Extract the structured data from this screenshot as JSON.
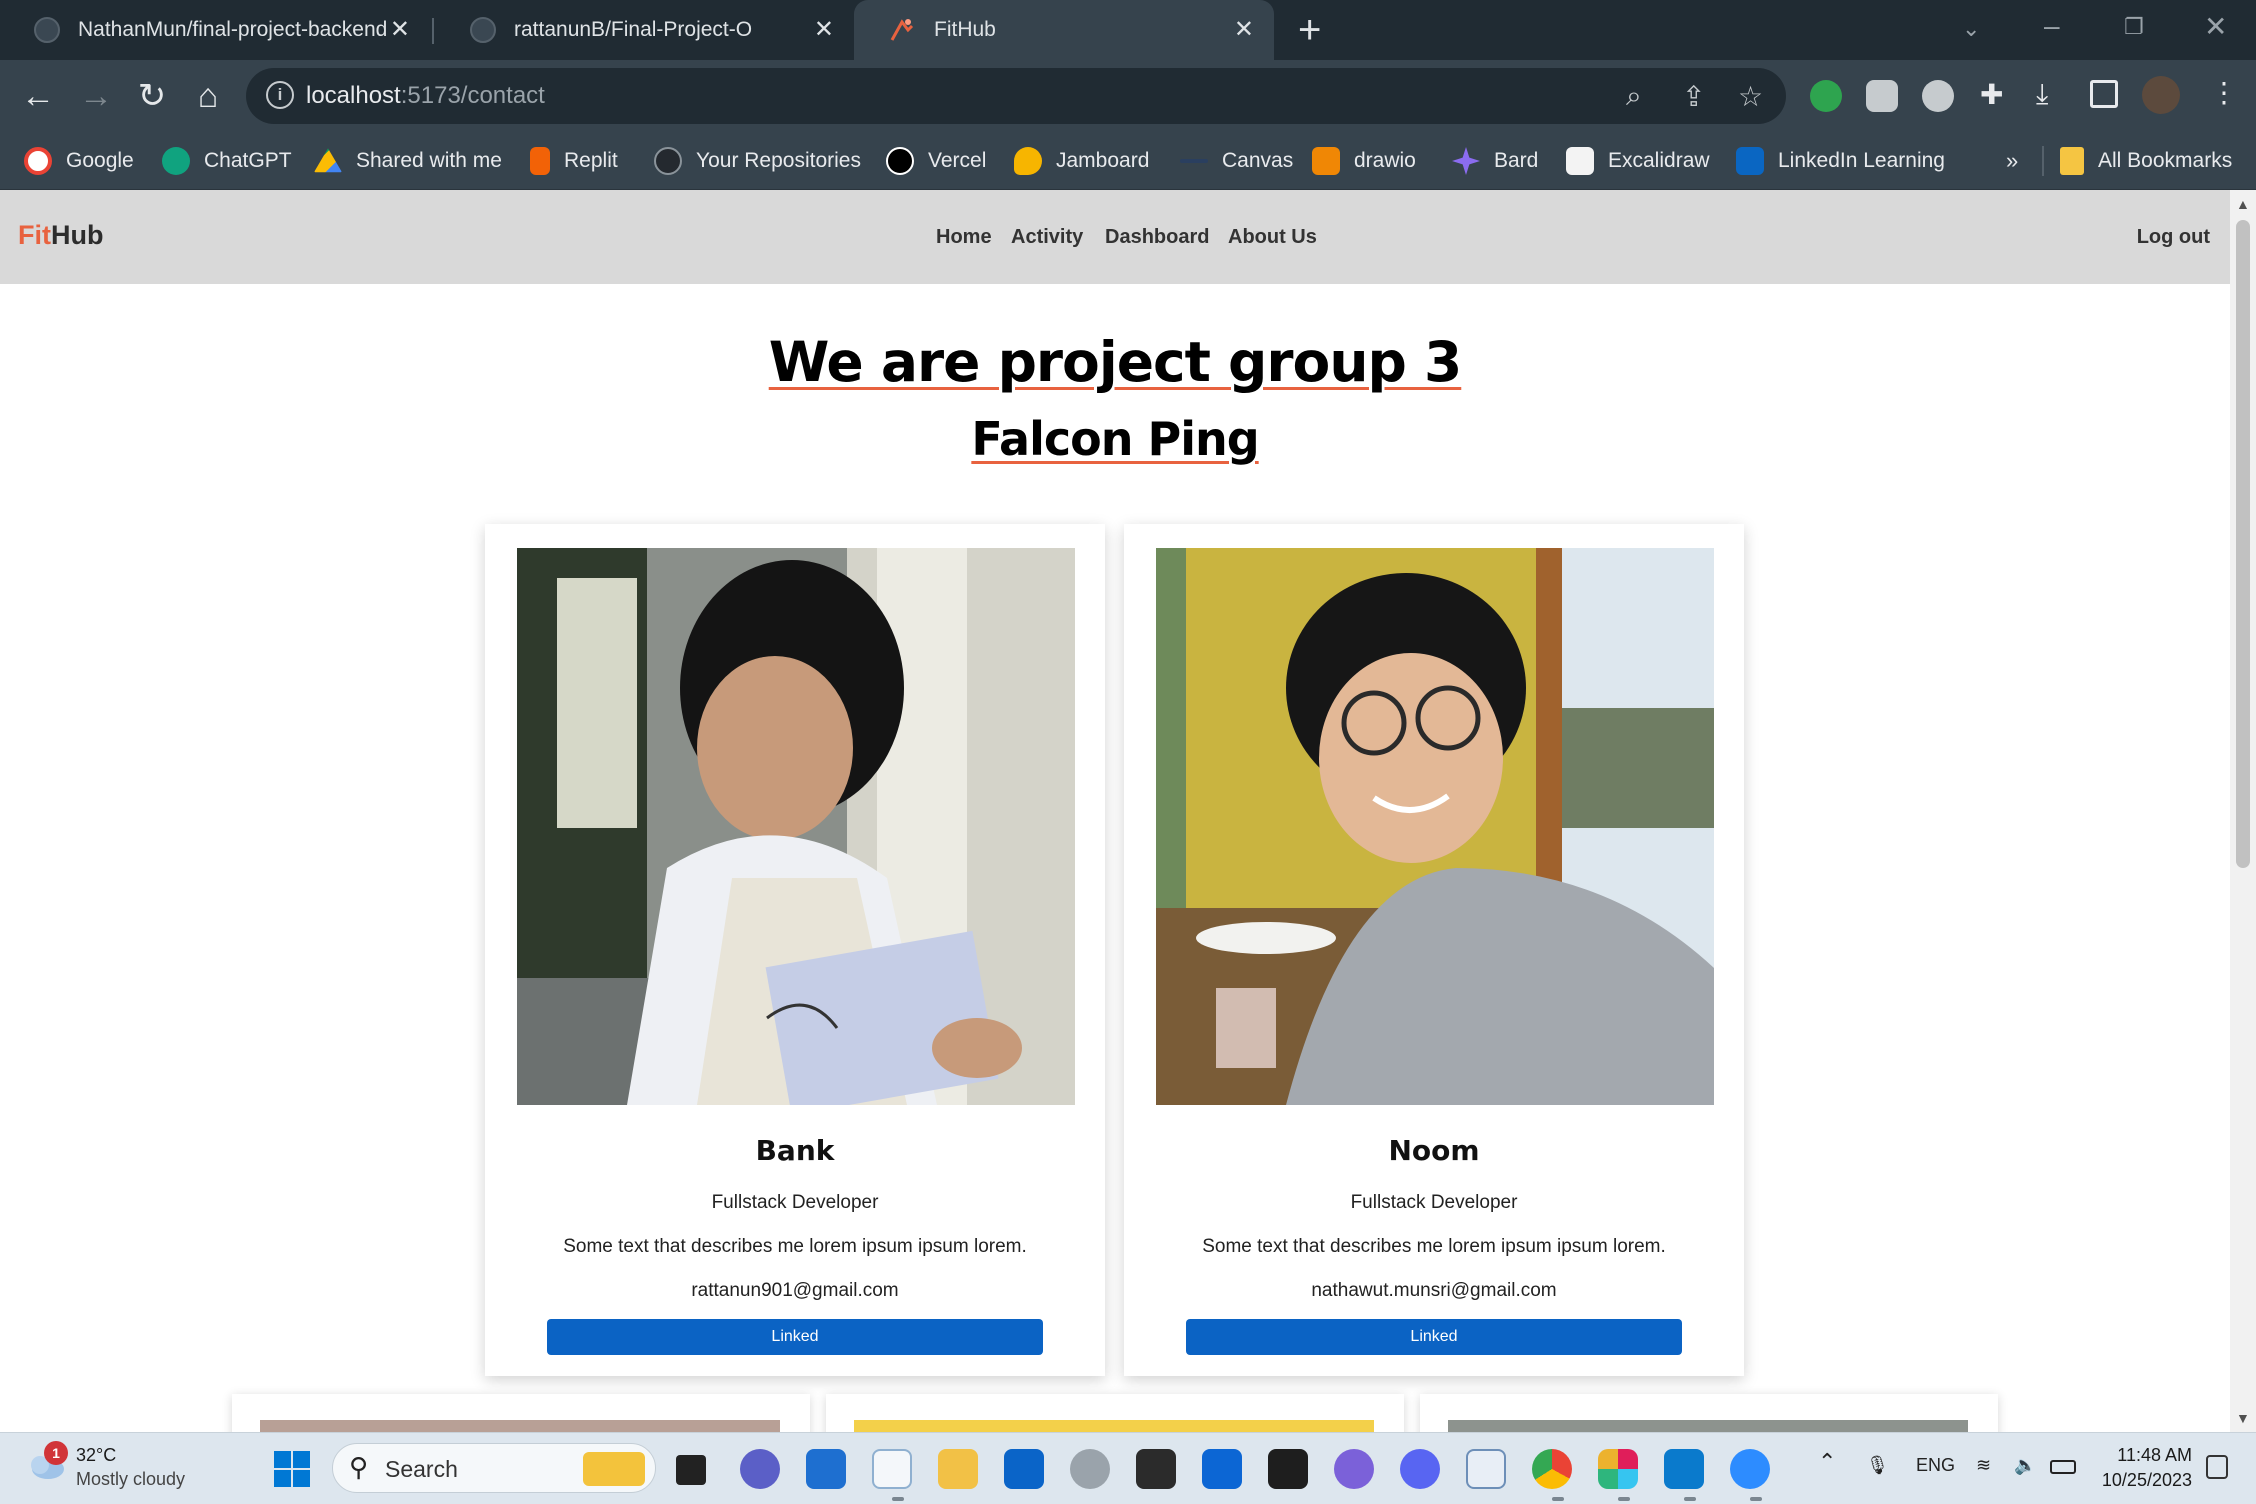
{
  "browser": {
    "tabs": [
      {
        "title": "NathanMun/final-project-backend",
        "active": false
      },
      {
        "title": "rattanunB/Final-Project-O",
        "active": false
      },
      {
        "title": "FitHub",
        "active": true
      }
    ],
    "url_host": "localhost",
    "url_rest": ":5173/contact",
    "bookmarks": [
      {
        "label": "Google",
        "color": "#ea4335"
      },
      {
        "label": "ChatGPT",
        "color": "#10a37f"
      },
      {
        "label": "Shared with me",
        "color": "#fbbc04"
      },
      {
        "label": "Replit",
        "color": "#f26207"
      },
      {
        "label": "Your Repositories",
        "color": "#24292f"
      },
      {
        "label": "Vercel",
        "color": "#000000"
      },
      {
        "label": "Jamboard",
        "color": "#f7b500"
      },
      {
        "label": "Canvas",
        "color": "#2a3f5f"
      },
      {
        "label": "drawio",
        "color": "#f08705"
      },
      {
        "label": "Bard",
        "color": "#8b6cf0"
      },
      {
        "label": "Excalidraw",
        "color": "#f3f3f3"
      },
      {
        "label": "LinkedIn Learning",
        "color": "#0a66c2"
      }
    ],
    "bookmarks_overflow": "»",
    "all_bookmarks": "All Bookmarks"
  },
  "site": {
    "brand_fit": "Fit",
    "brand_hub": "Hub",
    "nav": [
      "Home",
      "Activity",
      "Dashboard",
      "About Us"
    ],
    "logout": "Log out",
    "headline": "We are project group 3",
    "subheadline": "Falcon Ping",
    "members": [
      {
        "name": "Bank",
        "role": "Fullstack Developer",
        "bio": "Some text that describes me lorem ipsum ipsum lorem.",
        "email": "rattanun901@gmail.com",
        "button": "Linked"
      },
      {
        "name": "Noom",
        "role": "Fullstack Developer",
        "bio": "Some text that describes me lorem ipsum ipsum lorem.",
        "email": "nathawut.munsri@gmail.com",
        "button": "Linked"
      }
    ]
  },
  "taskbar": {
    "weather_badge": "1",
    "weather_temp": "32°C",
    "weather_desc": "Mostly cloudy",
    "search": "Search",
    "language": "ENG",
    "time": "11:48 AM",
    "date": "10/25/2023"
  },
  "colors": {
    "accent": "#e8623f",
    "button": "#0b63c4",
    "browser_frame": "#36434d"
  }
}
